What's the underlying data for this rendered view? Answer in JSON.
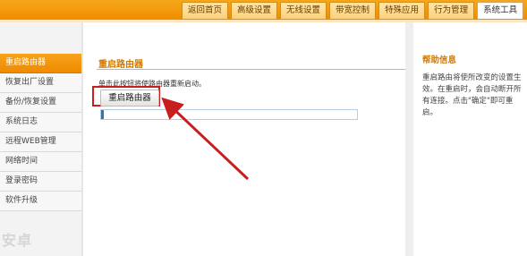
{
  "tabs": [
    {
      "label": "返回首页",
      "active": false
    },
    {
      "label": "高级设置",
      "active": false
    },
    {
      "label": "无线设置",
      "active": false
    },
    {
      "label": "带宽控制",
      "active": false
    },
    {
      "label": "特殊应用",
      "active": false
    },
    {
      "label": "行为管理",
      "active": false
    },
    {
      "label": "系统工具",
      "active": true
    }
  ],
  "sidebar": {
    "items": [
      {
        "label": "重启路由器",
        "active": true
      },
      {
        "label": "恢复出厂设置",
        "active": false
      },
      {
        "label": "备份/恢复设置",
        "active": false
      },
      {
        "label": "系统日志",
        "active": false
      },
      {
        "label": "远程WEB管理",
        "active": false
      },
      {
        "label": "网络时间",
        "active": false
      },
      {
        "label": "登录密码",
        "active": false
      },
      {
        "label": "软件升级",
        "active": false
      }
    ]
  },
  "main": {
    "title": "重启路由器",
    "description": "单击此按钮将使路由器重新启动。",
    "reboot_button": "重启路由器",
    "progress_fraction": 0.01
  },
  "help": {
    "title": "帮助信息",
    "text": "重启路由将使所改变的设置生效。在重启时，会自动断开所有连接。点击\"确定\"即可重启。"
  },
  "watermark": "安卓",
  "colors": {
    "accent": "#f08c00",
    "highlight_box": "#c81e1e",
    "progress": "#3a6fb0"
  }
}
